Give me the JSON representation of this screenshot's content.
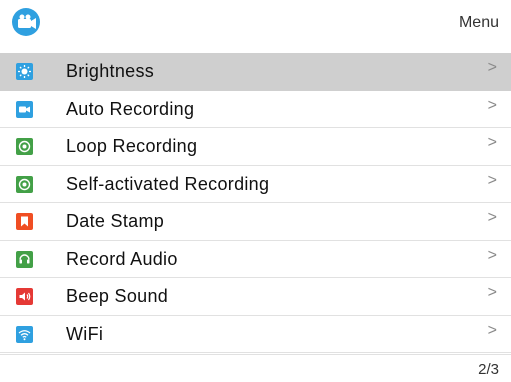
{
  "header": {
    "title": "Menu",
    "app_icon": "camera-icon",
    "accent_color": "#2fa0e0"
  },
  "menu": {
    "selected_index": 0,
    "items": [
      {
        "label": "Brightness",
        "icon": "brightness-icon",
        "icon_color": "#2fa0e0",
        "chevron": ">"
      },
      {
        "label": "Auto Recording",
        "icon": "auto-recording-icon",
        "icon_color": "#2fa0e0",
        "chevron": ">"
      },
      {
        "label": "Loop Recording",
        "icon": "loop-recording-icon",
        "icon_color": "#43a047",
        "chevron": ">"
      },
      {
        "label": "Self-activated Recording",
        "icon": "self-activated-recording-icon",
        "icon_color": "#43a047",
        "chevron": ">"
      },
      {
        "label": "Date Stamp",
        "icon": "date-stamp-icon",
        "icon_color": "#f04e23",
        "chevron": ">"
      },
      {
        "label": "Record Audio",
        "icon": "record-audio-icon",
        "icon_color": "#43a047",
        "chevron": ">"
      },
      {
        "label": "Beep Sound",
        "icon": "beep-sound-icon",
        "icon_color": "#e53935",
        "chevron": ">"
      },
      {
        "label": "WiFi",
        "icon": "wifi-icon",
        "icon_color": "#2fa0e0",
        "chevron": ">"
      }
    ]
  },
  "footer": {
    "page_indicator": "2/3"
  }
}
